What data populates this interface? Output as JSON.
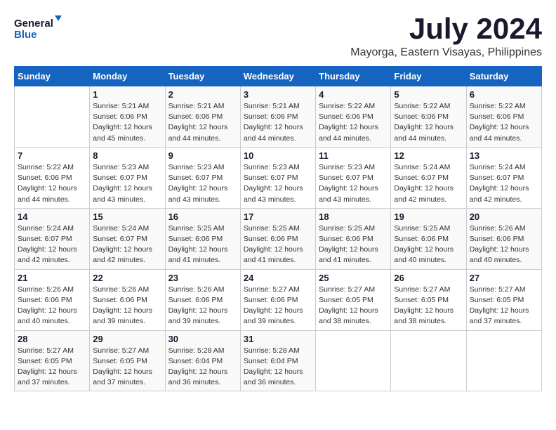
{
  "logo": {
    "line1": "General",
    "line2": "Blue"
  },
  "title": "July 2024",
  "location": "Mayorga, Eastern Visayas, Philippines",
  "days_of_week": [
    "Sunday",
    "Monday",
    "Tuesday",
    "Wednesday",
    "Thursday",
    "Friday",
    "Saturday"
  ],
  "weeks": [
    [
      {
        "day": "",
        "detail": ""
      },
      {
        "day": "1",
        "detail": "Sunrise: 5:21 AM\nSunset: 6:06 PM\nDaylight: 12 hours\nand 45 minutes."
      },
      {
        "day": "2",
        "detail": "Sunrise: 5:21 AM\nSunset: 6:06 PM\nDaylight: 12 hours\nand 44 minutes."
      },
      {
        "day": "3",
        "detail": "Sunrise: 5:21 AM\nSunset: 6:06 PM\nDaylight: 12 hours\nand 44 minutes."
      },
      {
        "day": "4",
        "detail": "Sunrise: 5:22 AM\nSunset: 6:06 PM\nDaylight: 12 hours\nand 44 minutes."
      },
      {
        "day": "5",
        "detail": "Sunrise: 5:22 AM\nSunset: 6:06 PM\nDaylight: 12 hours\nand 44 minutes."
      },
      {
        "day": "6",
        "detail": "Sunrise: 5:22 AM\nSunset: 6:06 PM\nDaylight: 12 hours\nand 44 minutes."
      }
    ],
    [
      {
        "day": "7",
        "detail": "Sunrise: 5:22 AM\nSunset: 6:06 PM\nDaylight: 12 hours\nand 44 minutes."
      },
      {
        "day": "8",
        "detail": "Sunrise: 5:23 AM\nSunset: 6:07 PM\nDaylight: 12 hours\nand 43 minutes."
      },
      {
        "day": "9",
        "detail": "Sunrise: 5:23 AM\nSunset: 6:07 PM\nDaylight: 12 hours\nand 43 minutes."
      },
      {
        "day": "10",
        "detail": "Sunrise: 5:23 AM\nSunset: 6:07 PM\nDaylight: 12 hours\nand 43 minutes."
      },
      {
        "day": "11",
        "detail": "Sunrise: 5:23 AM\nSunset: 6:07 PM\nDaylight: 12 hours\nand 43 minutes."
      },
      {
        "day": "12",
        "detail": "Sunrise: 5:24 AM\nSunset: 6:07 PM\nDaylight: 12 hours\nand 42 minutes."
      },
      {
        "day": "13",
        "detail": "Sunrise: 5:24 AM\nSunset: 6:07 PM\nDaylight: 12 hours\nand 42 minutes."
      }
    ],
    [
      {
        "day": "14",
        "detail": "Sunrise: 5:24 AM\nSunset: 6:07 PM\nDaylight: 12 hours\nand 42 minutes."
      },
      {
        "day": "15",
        "detail": "Sunrise: 5:24 AM\nSunset: 6:07 PM\nDaylight: 12 hours\nand 42 minutes."
      },
      {
        "day": "16",
        "detail": "Sunrise: 5:25 AM\nSunset: 6:06 PM\nDaylight: 12 hours\nand 41 minutes."
      },
      {
        "day": "17",
        "detail": "Sunrise: 5:25 AM\nSunset: 6:06 PM\nDaylight: 12 hours\nand 41 minutes."
      },
      {
        "day": "18",
        "detail": "Sunrise: 5:25 AM\nSunset: 6:06 PM\nDaylight: 12 hours\nand 41 minutes."
      },
      {
        "day": "19",
        "detail": "Sunrise: 5:25 AM\nSunset: 6:06 PM\nDaylight: 12 hours\nand 40 minutes."
      },
      {
        "day": "20",
        "detail": "Sunrise: 5:26 AM\nSunset: 6:06 PM\nDaylight: 12 hours\nand 40 minutes."
      }
    ],
    [
      {
        "day": "21",
        "detail": "Sunrise: 5:26 AM\nSunset: 6:06 PM\nDaylight: 12 hours\nand 40 minutes."
      },
      {
        "day": "22",
        "detail": "Sunrise: 5:26 AM\nSunset: 6:06 PM\nDaylight: 12 hours\nand 39 minutes."
      },
      {
        "day": "23",
        "detail": "Sunrise: 5:26 AM\nSunset: 6:06 PM\nDaylight: 12 hours\nand 39 minutes."
      },
      {
        "day": "24",
        "detail": "Sunrise: 5:27 AM\nSunset: 6:06 PM\nDaylight: 12 hours\nand 39 minutes."
      },
      {
        "day": "25",
        "detail": "Sunrise: 5:27 AM\nSunset: 6:05 PM\nDaylight: 12 hours\nand 38 minutes."
      },
      {
        "day": "26",
        "detail": "Sunrise: 5:27 AM\nSunset: 6:05 PM\nDaylight: 12 hours\nand 38 minutes."
      },
      {
        "day": "27",
        "detail": "Sunrise: 5:27 AM\nSunset: 6:05 PM\nDaylight: 12 hours\nand 37 minutes."
      }
    ],
    [
      {
        "day": "28",
        "detail": "Sunrise: 5:27 AM\nSunset: 6:05 PM\nDaylight: 12 hours\nand 37 minutes."
      },
      {
        "day": "29",
        "detail": "Sunrise: 5:27 AM\nSunset: 6:05 PM\nDaylight: 12 hours\nand 37 minutes."
      },
      {
        "day": "30",
        "detail": "Sunrise: 5:28 AM\nSunset: 6:04 PM\nDaylight: 12 hours\nand 36 minutes."
      },
      {
        "day": "31",
        "detail": "Sunrise: 5:28 AM\nSunset: 6:04 PM\nDaylight: 12 hours\nand 36 minutes."
      },
      {
        "day": "",
        "detail": ""
      },
      {
        "day": "",
        "detail": ""
      },
      {
        "day": "",
        "detail": ""
      }
    ]
  ]
}
